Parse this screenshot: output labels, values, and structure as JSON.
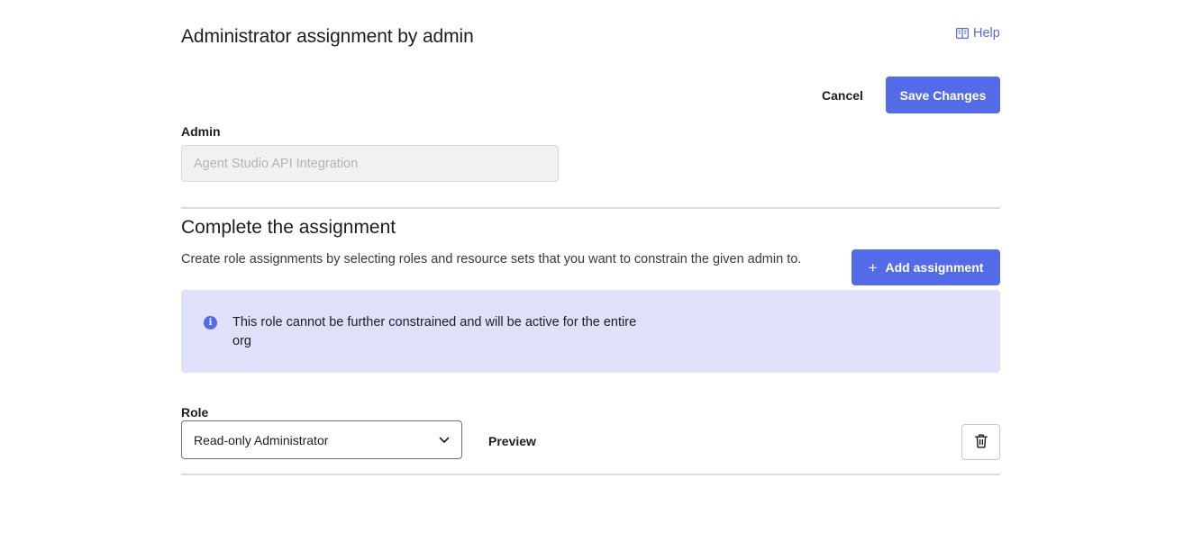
{
  "header": {
    "title": "Administrator assignment by admin",
    "help_label": "Help"
  },
  "actions": {
    "cancel_label": "Cancel",
    "save_label": "Save Changes"
  },
  "admin_field": {
    "label": "Admin",
    "placeholder": "Agent Studio API Integration"
  },
  "assignment": {
    "title": "Complete the assignment",
    "description": "Create role assignments by selecting roles and resource sets that you want to constrain the given admin to.",
    "add_label": "Add assignment",
    "add_icon": "+",
    "info_text": "This role cannot be further constrained and will be active for the entire org",
    "info_icon": "i"
  },
  "role": {
    "label": "Role",
    "selected": "Read-only Administrator",
    "preview_label": "Preview"
  },
  "icons": {
    "help": "book-icon",
    "info": "info-icon",
    "dropdown": "chevron-down-icon",
    "delete": "trash-icon"
  },
  "colors": {
    "accent": "#546be7",
    "callout_bg": "#dee1f9"
  }
}
